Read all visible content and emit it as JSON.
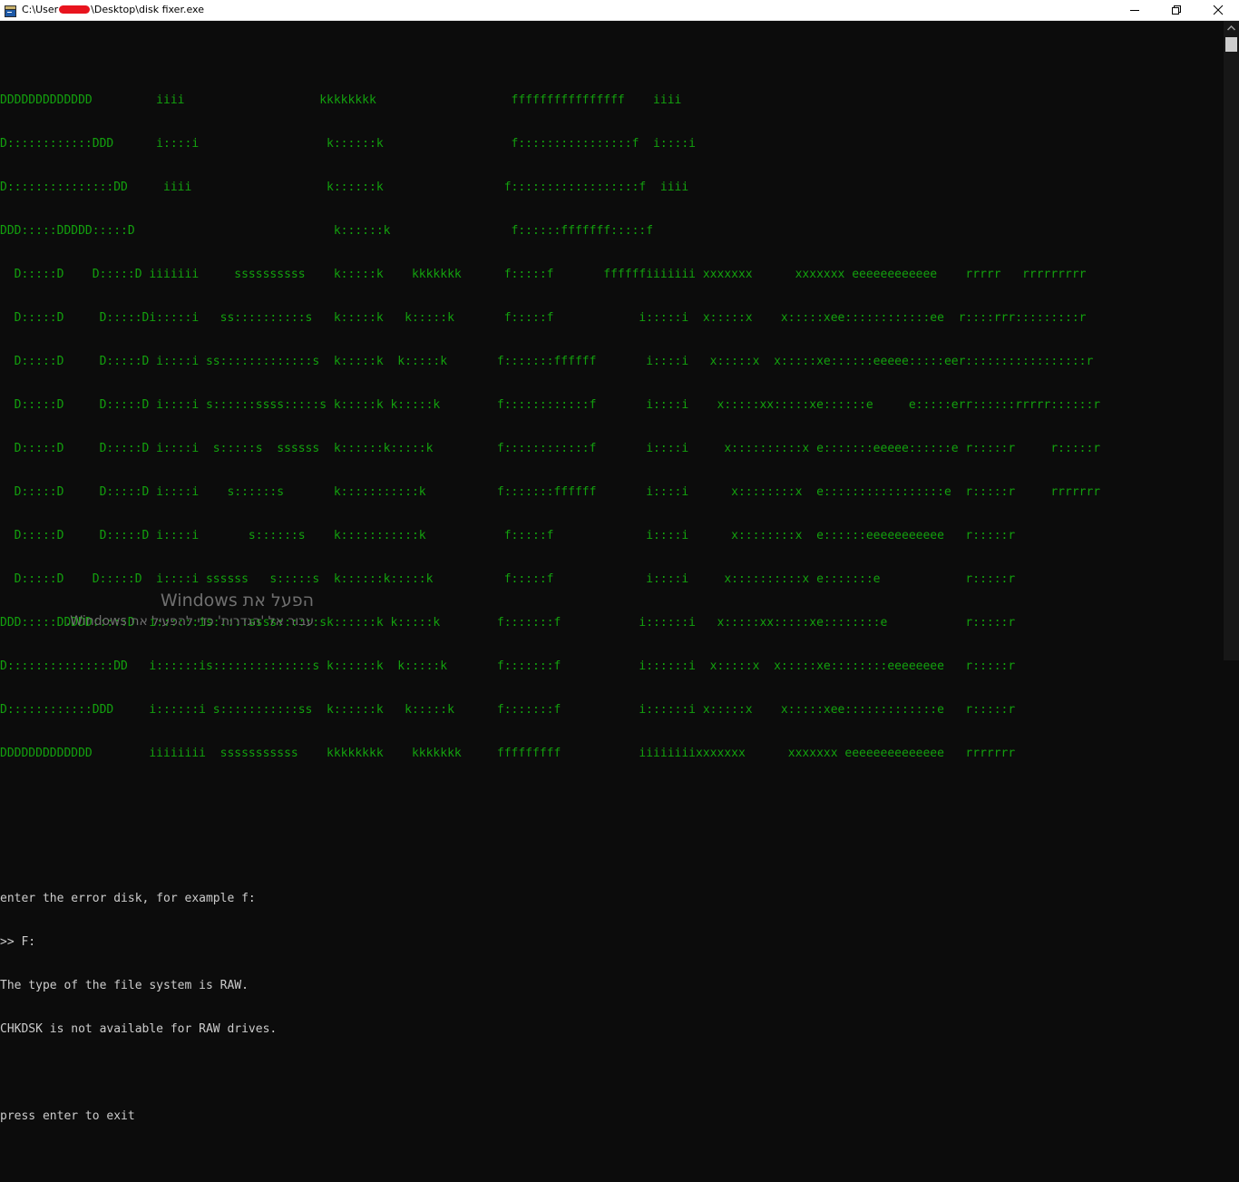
{
  "window": {
    "title_prefix": "C:\\User",
    "title_suffix": "\\Desktop\\disk fixer.exe",
    "icons": [
      "app-icon",
      "minimize-icon",
      "maximize-icon",
      "close-icon"
    ]
  },
  "console": {
    "ascii_lines": [
      "DDDDDDDDDDDDD         iiii                   kkkkkkkk                   ffffffffffffffff    iiii",
      "D::::::::::::DDD      i::::i                  k::::::k                  f::::::::::::::::f  i::::i",
      "D:::::::::::::::DD     iiii                   k::::::k                 f::::::::::::::::::f  iiii",
      "DDD:::::DDDDD:::::D                            k::::::k                 f::::::fffffff:::::f",
      "  D:::::D    D:::::D iiiiiii     ssssssssss    k:::::k    kkkkkkk      f:::::f       ffffffiiiiiii xxxxxxx      xxxxxxx eeeeeeeeeeee    rrrrr   rrrrrrrrr",
      "  D:::::D     D:::::Di:::::i   ss::::::::::s   k:::::k   k:::::k       f:::::f            i:::::i  x:::::x    x:::::xee::::::::::::ee  r::::rrr:::::::::r",
      "  D:::::D     D:::::D i::::i ss:::::::::::::s  k:::::k  k:::::k       f:::::::ffffff       i::::i   x:::::x  x:::::xe::::::eeeee:::::eer:::::::::::::::::r",
      "  D:::::D     D:::::D i::::i s::::::ssss:::::s k:::::k k:::::k        f::::::::::::f       i::::i    x:::::xx:::::xe::::::e     e:::::err::::::rrrrr::::::r",
      "  D:::::D     D:::::D i::::i  s:::::s  ssssss  k::::::k:::::k         f::::::::::::f       i::::i     x::::::::::x e:::::::eeeee::::::e r:::::r     r:::::r",
      "  D:::::D     D:::::D i::::i    s::::::s       k:::::::::::k          f:::::::ffffff       i::::i      x::::::::x  e:::::::::::::::::e  r:::::r     rrrrrrr",
      "  D:::::D     D:::::D i::::i       s::::::s    k:::::::::::k           f:::::f             i::::i      x::::::::x  e::::::eeeeeeeeeee   r:::::r",
      "  D:::::D    D:::::D  i::::i ssssss   s:::::s  k::::::k:::::k          f:::::f             i::::i     x::::::::::x e:::::::e            r:::::r",
      "DDD:::::DDDDD:::::D  i::::::is:::::ssss::::::sk::::::k k:::::k        f:::::::f           i::::::i   x:::::xx:::::xe::::::::e           r:::::r",
      "D:::::::::::::::DD   i::::::is::::::::::::::s k::::::k  k:::::k       f:::::::f           i::::::i  x:::::x  x:::::xe::::::::eeeeeeee   r:::::r",
      "D::::::::::::DDD     i::::::i s:::::::::::ss  k::::::k   k:::::k      f:::::::f           i::::::i x:::::x    x:::::xee:::::::::::::e   r:::::r",
      "DDDDDDDDDDDDD        iiiiiiii  sssssssssss    kkkkkkkk    kkkkkkk     fffffffff           iiiiiiiixxxxxxx      xxxxxxx eeeeeeeeeeeeee   rrrrrrr"
    ],
    "output_lines": [
      "",
      "enter the error disk, for example f:",
      ">> F:",
      "The type of the file system is RAW.",
      "CHKDSK is not available for RAW drives.",
      "",
      "press enter to exit"
    ]
  },
  "watermark": {
    "title": "הפעל את Windows",
    "subtitle": "עבור אל 'הגדרות' כדי להפעיל את Windows."
  },
  "colors": {
    "background": "#0c0c0c",
    "ascii_green": "#13a10e",
    "text_gray": "#cccccc",
    "watermark": "#6f6f6f"
  }
}
